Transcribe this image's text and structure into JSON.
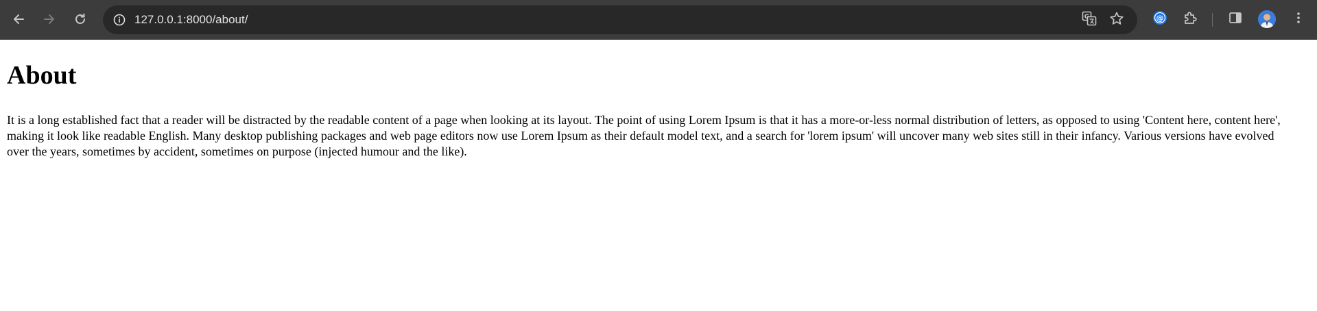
{
  "browser": {
    "url": "127.0.0.1:8000/about/",
    "colors": {
      "chrome_bg": "#3c3c3c",
      "omnibox_bg": "#282828",
      "icon": "#c7c7c7",
      "icon_disabled": "#7a7a7a",
      "accent": "#1a73e8"
    },
    "icons": {
      "back": "back-arrow-icon",
      "forward": "forward-arrow-icon",
      "reload": "reload-icon",
      "site_info": "info-circle-icon",
      "translate": "translate-icon",
      "bookmark": "star-icon",
      "extension_a": "at-sign-extension-icon",
      "extensions": "puzzle-icon",
      "side_panel": "side-panel-icon",
      "profile": "avatar",
      "menu": "kebab-menu-icon"
    }
  },
  "page": {
    "heading": "About",
    "paragraph": "It is a long established fact that a reader will be distracted by the readable content of a page when looking at its layout. The point of using Lorem Ipsum is that it has a more-or-less normal distribution of letters, as opposed to using 'Content here, content here', making it look like readable English. Many desktop publishing packages and web page editors now use Lorem Ipsum as their default model text, and a search for 'lorem ipsum' will uncover many web sites still in their infancy. Various versions have evolved over the years, sometimes by accident, sometimes on purpose (injected humour and the like)."
  }
}
